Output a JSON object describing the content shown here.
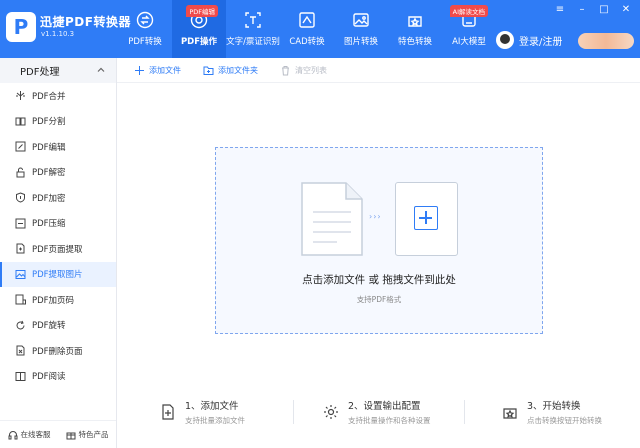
{
  "app": {
    "logo_letter": "P",
    "name": "迅捷PDF转换器",
    "version": "v1.1.10.3"
  },
  "nav": {
    "items": [
      {
        "label": "PDF转换",
        "icon": "convert-icon"
      },
      {
        "label": "PDF操作",
        "icon": "settings-circle-icon",
        "badge": "PDF编辑",
        "active": true
      },
      {
        "label": "文字/票证识别",
        "icon": "scan-icon"
      },
      {
        "label": "CAD转换",
        "icon": "cad-icon"
      },
      {
        "label": "图片转换",
        "icon": "image-icon"
      },
      {
        "label": "特色转换",
        "icon": "star-icon"
      },
      {
        "label": "AI大模型",
        "icon": "ai-icon",
        "badge": "AI解读文档"
      }
    ]
  },
  "header": {
    "login_label": "登录/注册"
  },
  "sidebar": {
    "section_title": "PDF处理",
    "items": [
      {
        "label": "PDF合并",
        "icon": "merge-icon"
      },
      {
        "label": "PDF分割",
        "icon": "split-icon"
      },
      {
        "label": "PDF编辑",
        "icon": "edit-icon"
      },
      {
        "label": "PDF解密",
        "icon": "unlock-icon"
      },
      {
        "label": "PDF加密",
        "icon": "shield-icon"
      },
      {
        "label": "PDF压缩",
        "icon": "compress-icon"
      },
      {
        "label": "PDF页面提取",
        "icon": "page-extract-icon"
      },
      {
        "label": "PDF提取图片",
        "icon": "image-extract-icon",
        "active": true
      },
      {
        "label": "PDF加页码",
        "icon": "page-number-icon"
      },
      {
        "label": "PDF旋转",
        "icon": "rotate-icon"
      },
      {
        "label": "PDF删除页面",
        "icon": "delete-page-icon"
      },
      {
        "label": "PDF阅读",
        "icon": "read-icon"
      }
    ],
    "footer": {
      "service_label": "在线客服",
      "products_label": "特色产品"
    }
  },
  "toolbar": {
    "add_file": "添加文件",
    "add_folder": "添加文件夹",
    "clear_list": "清空列表"
  },
  "dropzone": {
    "main_text": "点击添加文件 或 拖拽文件到此处",
    "sub_text": "支持PDF格式",
    "arrows": "›››"
  },
  "steps": [
    {
      "title": "1、添加文件",
      "sub": "支持批量添加文件"
    },
    {
      "title": "2、设置输出配置",
      "sub": "支持批量操作和各种设置"
    },
    {
      "title": "3、开始转换",
      "sub": "点击转换按钮开始转换"
    }
  ],
  "colors": {
    "accent": "#2f7cf6",
    "header_active": "#1f6ae3",
    "badge": "#f04b4b"
  }
}
